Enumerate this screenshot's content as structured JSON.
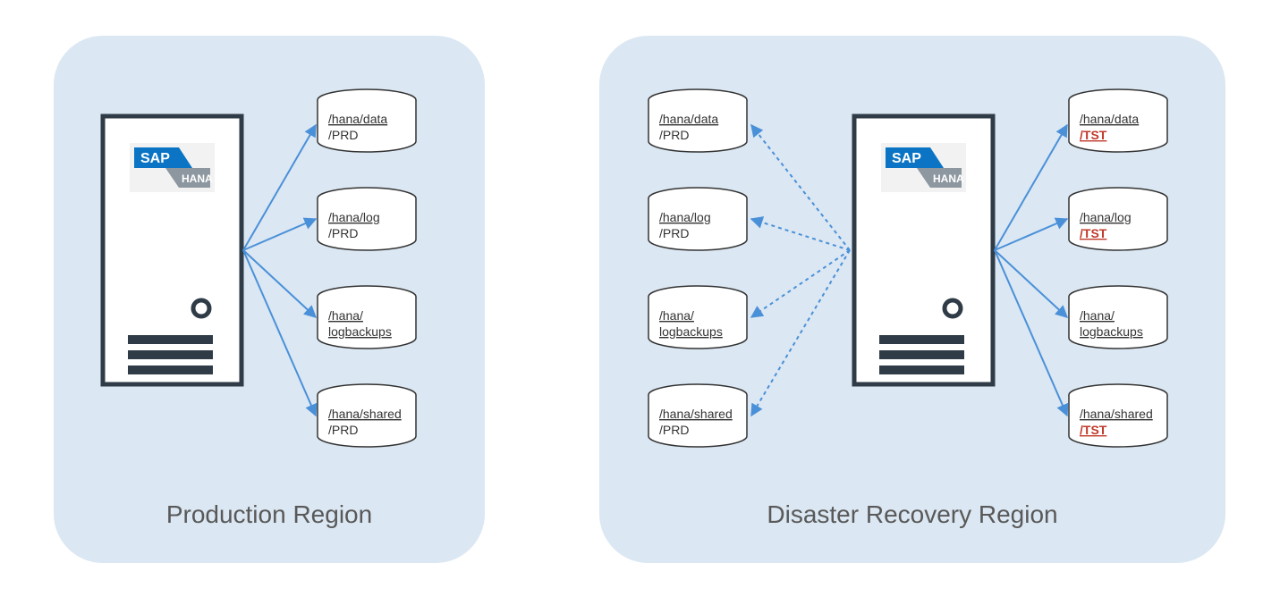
{
  "production": {
    "label": "Production Region",
    "server": {
      "logo_text1": "SAP",
      "logo_text2": "HANA"
    },
    "volumes": [
      {
        "line1": "/hana/data",
        "line2": "/PRD",
        "highlight2": false
      },
      {
        "line1": "/hana/log",
        "line2": "/PRD",
        "highlight2": false
      },
      {
        "line1": "/hana/",
        "line2": "logbackups",
        "highlight2": false
      },
      {
        "line1": "/hana/shared",
        "line2": "/PRD",
        "highlight2": false
      }
    ]
  },
  "dr": {
    "label": "Disaster Recovery Region",
    "server": {
      "logo_text1": "SAP",
      "logo_text2": "HANA"
    },
    "volumes_left": [
      {
        "line1": "/hana/data",
        "line2": "/PRD",
        "highlight2": false
      },
      {
        "line1": "/hana/log",
        "line2": "/PRD",
        "highlight2": false
      },
      {
        "line1": "/hana/",
        "line2": "logbackups",
        "highlight2": false
      },
      {
        "line1": "/hana/shared",
        "line2": "/PRD",
        "highlight2": false
      }
    ],
    "volumes_right": [
      {
        "line1": "/hana/data",
        "line2": "/TST",
        "highlight2": true
      },
      {
        "line1": "/hana/log",
        "line2": "/TST",
        "highlight2": true
      },
      {
        "line1": "/hana/",
        "line2": "logbackups",
        "highlight2": false
      },
      {
        "line1": "/hana/shared",
        "line2": "/TST",
        "highlight2": true
      }
    ]
  },
  "colors": {
    "regionFill": "#dbe7f2",
    "arrowSolid": "#4a90d9",
    "arrowDotted": "#4a90d9",
    "serverStroke": "#2f3b46",
    "sapBlue": "#0b74c4",
    "hanaGray": "#8d97a0"
  }
}
